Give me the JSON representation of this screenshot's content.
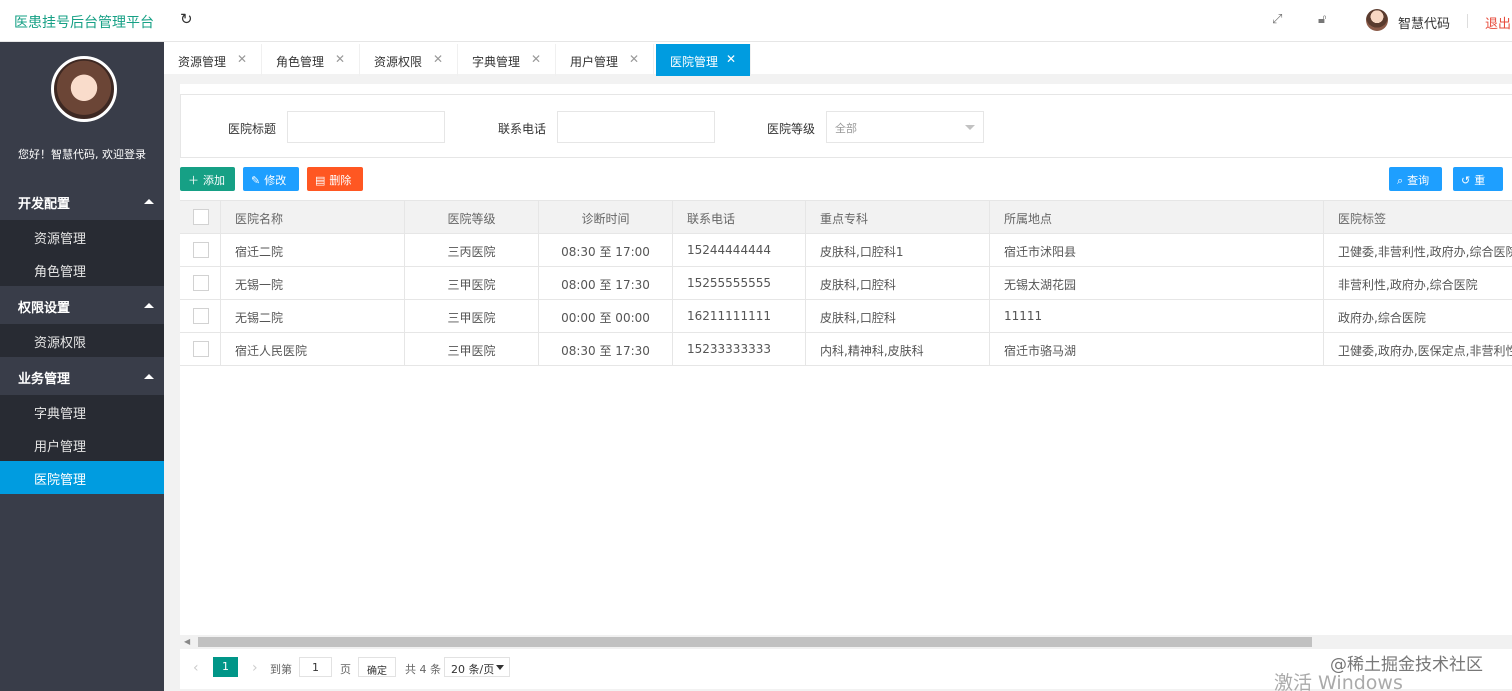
{
  "header": {
    "title": "医患挂号后台管理平台",
    "username": "智慧代码",
    "logout": "退出",
    "icons": [
      "refresh-icon",
      "fullscreen-icon",
      "lock-icon"
    ]
  },
  "sidebar": {
    "welcome": "您好！智慧代码, 欢迎登录",
    "groups": [
      {
        "label": "开发配置",
        "items": [
          "资源管理",
          "角色管理"
        ]
      },
      {
        "label": "权限设置",
        "items": [
          "资源权限"
        ]
      },
      {
        "label": "业务管理",
        "items": [
          "字典管理",
          "用户管理",
          "医院管理"
        ]
      }
    ],
    "active_item": "医院管理"
  },
  "tabs": [
    {
      "label": "资源管理"
    },
    {
      "label": "角色管理"
    },
    {
      "label": "资源权限"
    },
    {
      "label": "字典管理"
    },
    {
      "label": "用户管理"
    },
    {
      "label": "医院管理",
      "active": true
    }
  ],
  "search": {
    "title_label": "医院标题",
    "phone_label": "联系电话",
    "level_label": "医院等级",
    "level_value": "全部"
  },
  "buttons": {
    "add": "添加",
    "edit": "修改",
    "delete": "删除",
    "query": "查询",
    "reset": "重置"
  },
  "table": {
    "columns": [
      "医院名称",
      "医院等级",
      "诊断时间",
      "联系电话",
      "重点专科",
      "所属地点",
      "医院标签"
    ],
    "rows": [
      [
        "宿迁二院",
        "三丙医院",
        "08:30 至 17:00",
        "15244444444",
        "皮肤科,口腔科1",
        "宿迁市沭阳县",
        "卫健委,非营利性,政府办,综合医院,"
      ],
      [
        "无锡一院",
        "三甲医院",
        "08:00 至 17:30",
        "15255555555",
        "皮肤科,口腔科",
        "无锡太湖花园",
        "非营利性,政府办,综合医院"
      ],
      [
        "无锡二院",
        "三甲医院",
        "00:00 至 00:00",
        "16211111111",
        "皮肤科,口腔科",
        "11111",
        "政府办,综合医院"
      ],
      [
        "宿迁人民医院",
        "三甲医院",
        "08:30 至 17:30",
        "15233333333",
        "内科,精神科,皮肤科",
        "宿迁市骆马湖",
        "卫健委,政府办,医保定点,非营利性"
      ]
    ]
  },
  "pager": {
    "current": "1",
    "goto": "到第",
    "page_input": "1",
    "page_unit": "页",
    "confirm": "确定",
    "total": "共 4 条",
    "size": "20 条/页"
  },
  "watermark": {
    "line1": "@稀土掘金技术社区",
    "line2": "激活 Windows"
  }
}
